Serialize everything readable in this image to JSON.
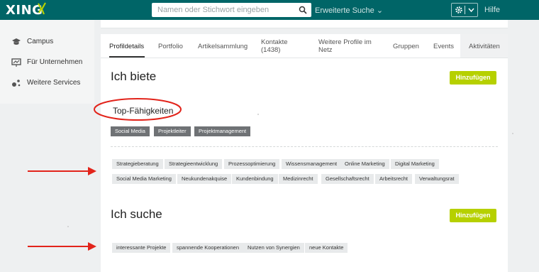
{
  "header": {
    "logo_text": "XING",
    "search_placeholder": "Namen oder Stichwort eingeben",
    "advanced_search": "Erweiterte Suche",
    "help": "Hilfe"
  },
  "sidebar": {
    "items": [
      {
        "label": "Campus",
        "icon": "graduation-cap-icon"
      },
      {
        "label": "Für Unternehmen",
        "icon": "presentation-icon"
      },
      {
        "label": "Weitere Services",
        "icon": "dots-icon"
      }
    ]
  },
  "tabs": [
    {
      "label": "Profildetails",
      "active": true
    },
    {
      "label": "Portfolio"
    },
    {
      "label": "Artikelsammlung"
    },
    {
      "label": "Kontakte\n(1438)"
    },
    {
      "label": "Weitere Profile im\nNetz"
    },
    {
      "label": "Gruppen"
    },
    {
      "label": "Events"
    },
    {
      "label": "Aktivitäten"
    }
  ],
  "offer": {
    "title": "Ich biete",
    "add_button": "Hinzufügen",
    "top_skills_title": "Top-Fähigkeiten",
    "top_skills": [
      "Social Media",
      "Projektleiter",
      "Projektmanagement"
    ],
    "skills_row1": [
      "Strategieberatung",
      "Strategieentwicklung",
      "Prozessoptimierung",
      "Wissensmanagement",
      "Online Marketing",
      "Digital Marketing"
    ],
    "skills_row2": [
      "Social Media Marketing",
      "Neukundenakquise",
      "Kundenbindung",
      "Medizinrecht",
      "Gesellschaftsrecht",
      "Arbeitsrecht",
      "Verwaltungsrat"
    ]
  },
  "seek": {
    "title": "Ich suche",
    "add_button": "Hinzufügen",
    "items": [
      "interessante Projekte",
      "spannende Kooperationen",
      "Nutzen von Synergien",
      "neue Kontakte"
    ]
  },
  "colors": {
    "header_bg": "#006567",
    "accent_green": "#b6d000",
    "annotation_red": "#e2241b"
  }
}
